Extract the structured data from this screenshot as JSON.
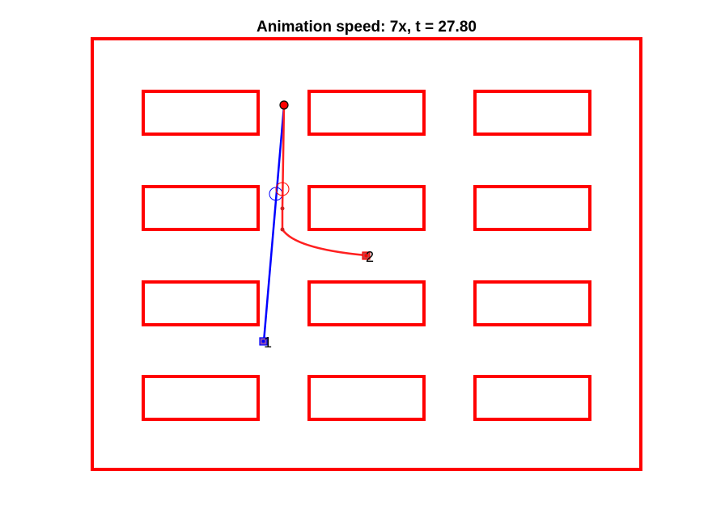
{
  "title": "Animation speed: 7x, t = 27.80",
  "colors": {
    "walls": "#ff0000",
    "agent_1": "#0000ff",
    "agent_2": "#ff0000",
    "start_marker_fill": "#ff0000",
    "goal_marker_fill": "#8a4fb3"
  },
  "agents": [
    {
      "id": "agent-1",
      "label": "1",
      "color_key": "agent_1"
    },
    {
      "id": "agent-2",
      "label": "2",
      "color_key": "agent_2"
    }
  ]
}
